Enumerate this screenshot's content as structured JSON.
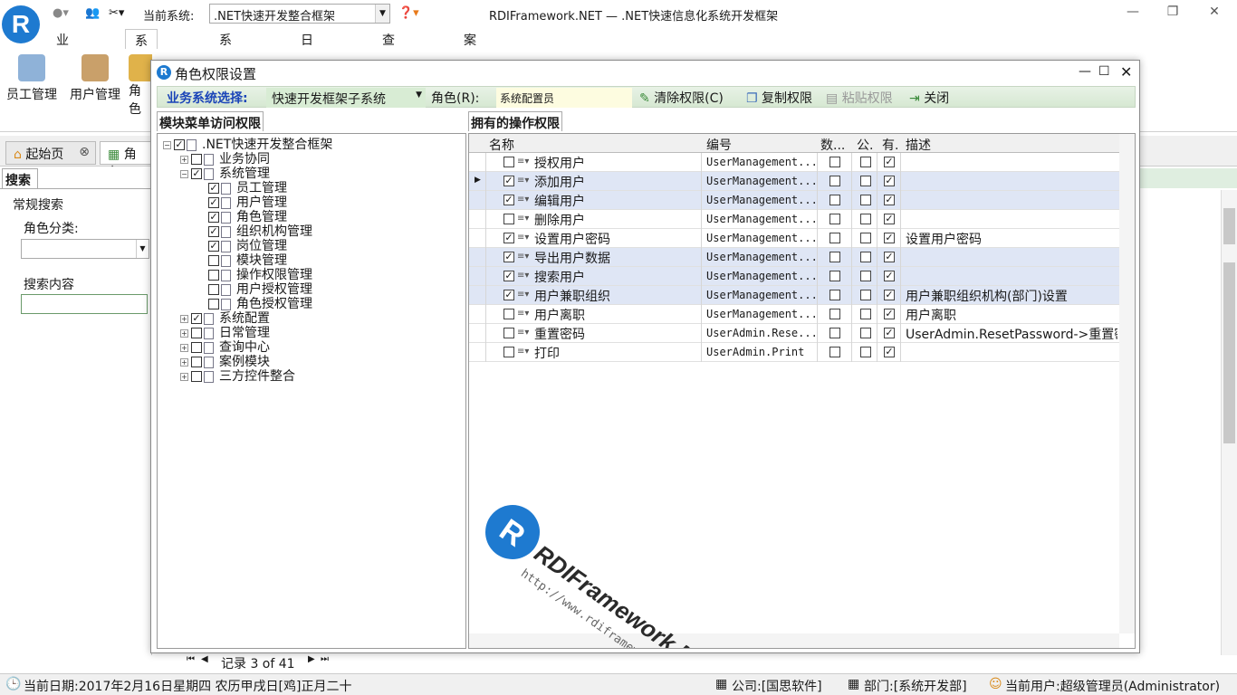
{
  "app": {
    "title": "RDIFramework.NET — .NET快速信息化系统开发框架",
    "current_system_label": "当前系统:",
    "current_system_value": ".NET快速开发整合框架",
    "logo_letter": "R"
  },
  "ribbon_tabs": [
    "业务协同",
    "系统管理",
    "系统配置",
    "日常管理",
    "查询中心",
    "案例模块"
  ],
  "ribbon_buttons": [
    "员工管理",
    "用户管理",
    "角色"
  ],
  "doc_tabs": [
    "起始页",
    "角色"
  ],
  "left_panel": {
    "tab": "搜索",
    "group": "常规搜索",
    "role_category_label": "角色分类:",
    "role_category_value": "",
    "search_label": "搜索内容",
    "search_value": ""
  },
  "dialog": {
    "title": "角色权限设置",
    "toolbar": {
      "biz_label": "业务系统选择:",
      "biz_value": "快速开发框架子系统",
      "role_label": "角色(R):",
      "role_value": "系统配置员",
      "clear": "清除权限(C)",
      "copy": "复制权限",
      "paste": "粘贴权限",
      "close": "关闭"
    },
    "tree_tab": "模块菜单访问权限",
    "grid_tab": "拥有的操作权限",
    "tree": [
      {
        "label": ".NET快速开发整合框架",
        "level": 0,
        "expander": "−",
        "checked": true
      },
      {
        "label": "业务协同",
        "level": 1,
        "expander": "+",
        "checked": false
      },
      {
        "label": "系统管理",
        "level": 1,
        "expander": "−",
        "checked": true
      },
      {
        "label": "员工管理",
        "level": 2,
        "expander": "",
        "checked": true
      },
      {
        "label": "用户管理",
        "level": 2,
        "expander": "",
        "checked": true
      },
      {
        "label": "角色管理",
        "level": 2,
        "expander": "",
        "checked": true
      },
      {
        "label": "组织机构管理",
        "level": 2,
        "expander": "",
        "checked": true
      },
      {
        "label": "岗位管理",
        "level": 2,
        "expander": "",
        "checked": true
      },
      {
        "label": "模块管理",
        "level": 2,
        "expander": "",
        "checked": false
      },
      {
        "label": "操作权限管理",
        "level": 2,
        "expander": "",
        "checked": false
      },
      {
        "label": "用户授权管理",
        "level": 2,
        "expander": "",
        "checked": false
      },
      {
        "label": "角色授权管理",
        "level": 2,
        "expander": "",
        "checked": false
      },
      {
        "label": "系统配置",
        "level": 1,
        "expander": "+",
        "checked": true
      },
      {
        "label": "日常管理",
        "level": 1,
        "expander": "+",
        "checked": false
      },
      {
        "label": "查询中心",
        "level": 1,
        "expander": "+",
        "checked": false
      },
      {
        "label": "案例模块",
        "level": 1,
        "expander": "+",
        "checked": false
      },
      {
        "label": "三方控件整合",
        "level": 1,
        "expander": "+",
        "checked": false
      }
    ],
    "grid": {
      "columns": [
        "名称",
        "编号",
        "数...",
        "公.",
        "有.",
        "描述"
      ],
      "rows": [
        {
          "checked": false,
          "name": "授权用户",
          "code": "UserManagement...",
          "c1": false,
          "c2": false,
          "c3": true,
          "desc": "",
          "sel": false
        },
        {
          "checked": true,
          "name": "添加用户",
          "code": "UserManagement...",
          "c1": false,
          "c2": false,
          "c3": true,
          "desc": "",
          "sel": true
        },
        {
          "checked": true,
          "name": "编辑用户",
          "code": "UserManagement...",
          "c1": false,
          "c2": false,
          "c3": true,
          "desc": "",
          "sel": true
        },
        {
          "checked": false,
          "name": "删除用户",
          "code": "UserManagement...",
          "c1": false,
          "c2": false,
          "c3": true,
          "desc": "",
          "sel": false
        },
        {
          "checked": true,
          "name": "设置用户密码",
          "code": "UserManagement...",
          "c1": false,
          "c2": false,
          "c3": true,
          "desc": "设置用户密码",
          "sel": false
        },
        {
          "checked": true,
          "name": "导出用户数据",
          "code": "UserManagement...",
          "c1": false,
          "c2": false,
          "c3": true,
          "desc": "",
          "sel": true
        },
        {
          "checked": true,
          "name": "搜索用户",
          "code": "UserManagement...",
          "c1": false,
          "c2": false,
          "c3": true,
          "desc": "",
          "sel": true
        },
        {
          "checked": true,
          "name": "用户兼职组织",
          "code": "UserManagement...",
          "c1": false,
          "c2": false,
          "c3": true,
          "desc": "用户兼职组织机构(部门)设置",
          "sel": true
        },
        {
          "checked": false,
          "name": "用户离职",
          "code": "UserManagement...",
          "c1": false,
          "c2": false,
          "c3": true,
          "desc": "用户离职",
          "sel": false
        },
        {
          "checked": false,
          "name": "重置密码",
          "code": "UserAdmin.Rese...",
          "c1": false,
          "c2": false,
          "c3": true,
          "desc": "UserAdmin.ResetPassword->重置密码",
          "sel": false
        },
        {
          "checked": false,
          "name": "打印",
          "code": "UserAdmin.Print",
          "c1": false,
          "c2": false,
          "c3": true,
          "desc": "",
          "sel": false
        }
      ]
    }
  },
  "pager": {
    "text": "记录 3 of 41"
  },
  "watermark": {
    "brand": "RDIFramework.NET",
    "url": "http://www.rdiframework.net/"
  },
  "status": {
    "date": "当前日期:2017年2月16日星期四 农历甲戌日[鸡]正月二十",
    "company": "公司:[国思软件]",
    "dept": "部门:[系统开发部]",
    "user": "当前用户:超级管理员(Administrator)"
  },
  "colors": {
    "accent": "#1e7ad0",
    "toolbar_green": "#d8ecd4",
    "selected_row": "#dfe6f5"
  }
}
